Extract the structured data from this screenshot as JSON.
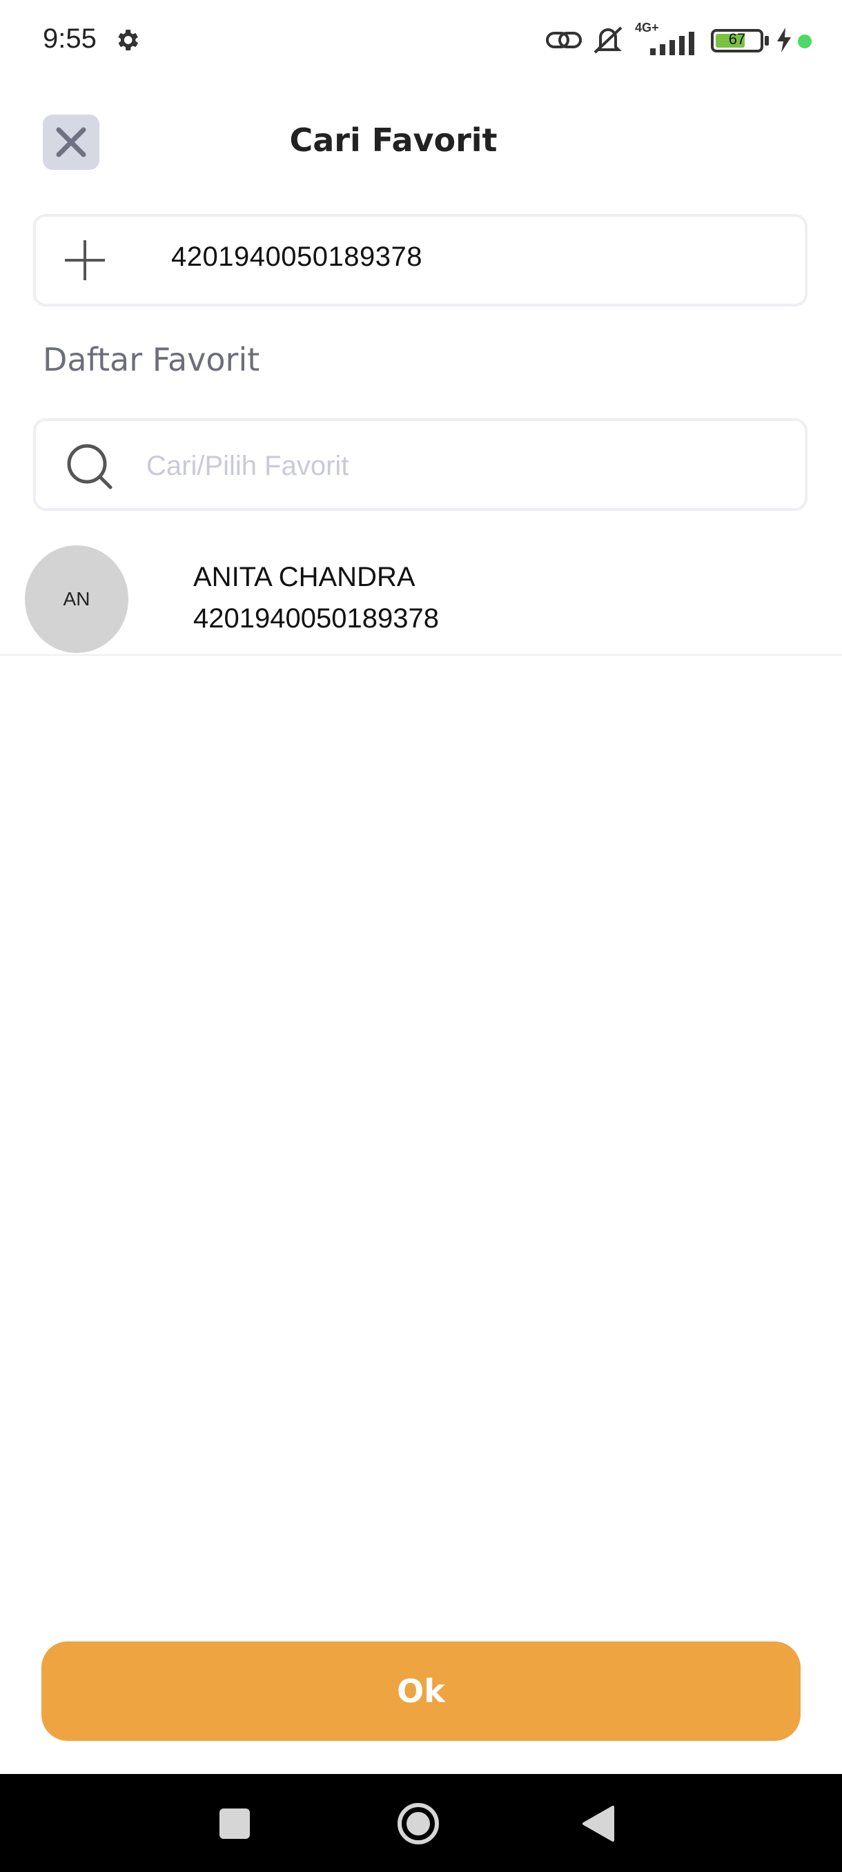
{
  "status_bar": {
    "time": "9:55",
    "battery_level": "67",
    "battery_fraction": 0.67,
    "icons": [
      "gear-icon",
      "link-icon",
      "mute-icon",
      "signal-4g-icon",
      "battery-icon",
      "charging-icon",
      "dot-icon"
    ],
    "network_label": "4G+"
  },
  "header": {
    "title": "Cari Favorit",
    "close_icon": "close-icon"
  },
  "account_input": {
    "value": "4201940050189378",
    "icon": "plus-icon"
  },
  "favorites": {
    "section_label": "Daftar Favorit",
    "search_placeholder": "Cari/Pilih Favorit",
    "items": [
      {
        "initials": "AN",
        "name": "ANITA CHANDRA",
        "number": "4201940050189378"
      }
    ]
  },
  "footer": {
    "ok_label": "Ok"
  },
  "colors": {
    "accent": "#eda441",
    "close_bg": "#d6d8e3",
    "avatar_bg": "#d3d3d3",
    "section_label": "#6c6e7a",
    "placeholder": "#c9cad6"
  }
}
